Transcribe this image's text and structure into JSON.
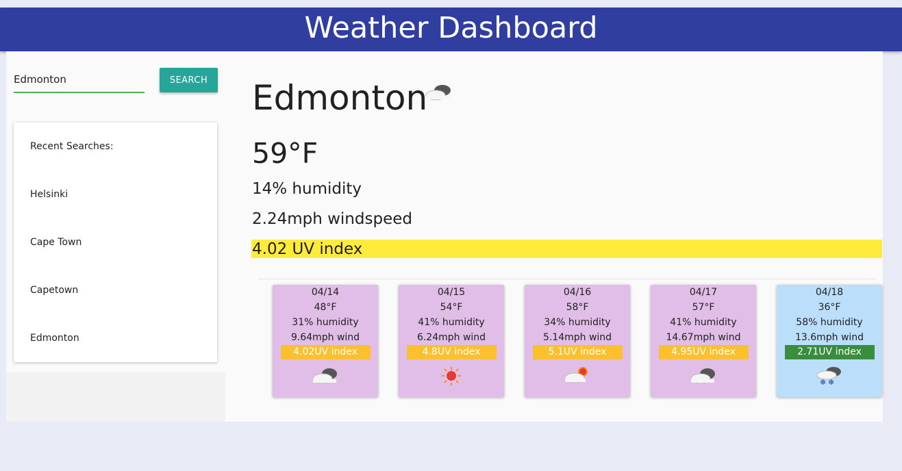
{
  "header": {
    "title": "Weather Dashboard"
  },
  "search": {
    "value": "Edmonton",
    "button_label": "SEARCH"
  },
  "recent": {
    "title": "Recent Searches:",
    "items": [
      "Helsinki",
      "Cape Town",
      "Capetown",
      "Edmonton"
    ]
  },
  "current": {
    "city": "Edmonton",
    "icon": "cloudy-icon",
    "temp": "59°F",
    "humidity": "14% humidity",
    "wind": "2.24mph windspeed",
    "uv": "4.02 UV index",
    "uv_color": "#ffeb3b"
  },
  "forecast": [
    {
      "date": "04/14",
      "temp": "48°F",
      "humidity": "31% humidity",
      "wind": "9.64mph wind",
      "uv": "4.02UV index",
      "uv_color": "#fbc02d",
      "bg": "#e1bee7",
      "icon": "cloudy-icon"
    },
    {
      "date": "04/15",
      "temp": "54°F",
      "humidity": "41% humidity",
      "wind": "6.24mph wind",
      "uv": "4.8UV index",
      "uv_color": "#fbc02d",
      "bg": "#e1bee7",
      "icon": "sun-icon"
    },
    {
      "date": "04/16",
      "temp": "58°F",
      "humidity": "34% humidity",
      "wind": "5.14mph wind",
      "uv": "5.1UV index",
      "uv_color": "#fbc02d",
      "bg": "#e1bee7",
      "icon": "partly-cloudy-icon"
    },
    {
      "date": "04/17",
      "temp": "57°F",
      "humidity": "41% humidity",
      "wind": "14.67mph wind",
      "uv": "4.95UV index",
      "uv_color": "#fbc02d",
      "bg": "#e1bee7",
      "icon": "cloudy-icon"
    },
    {
      "date": "04/18",
      "temp": "36°F",
      "humidity": "58% humidity",
      "wind": "13.6mph wind",
      "uv": "2.71UV index",
      "uv_color": "#388e3c",
      "bg": "#bbdefb",
      "icon": "snow-icon"
    }
  ]
}
